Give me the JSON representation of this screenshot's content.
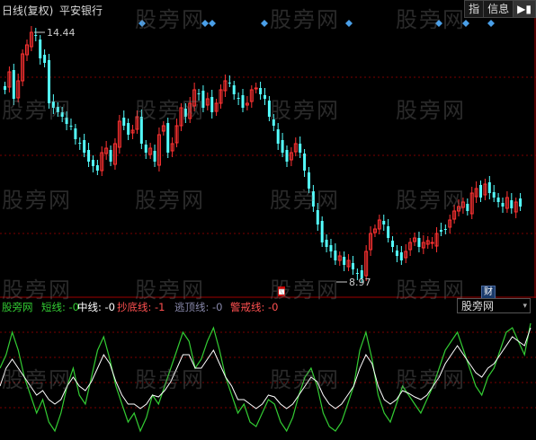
{
  "header": {
    "chart_type_label": "日线(复权)",
    "stock_name": "平安银行"
  },
  "toolbar": {
    "index_button": "指",
    "info_button": "信息",
    "expand_icon": "expand-arrow-icon"
  },
  "main_chart": {
    "high_label": "14.44",
    "low_label": "8.97",
    "finance_marker": "财",
    "colors": {
      "up": "#ff3232",
      "down": "#54ffff",
      "grid": "#7a0000",
      "event_diamond": "#4a9fe8"
    }
  },
  "indicator": {
    "name": "股旁网",
    "short_line": "短线: -0",
    "mid_line": "中线: -0",
    "bottom_line": "抄底线: -1",
    "escape_line": "逃顶线: -0",
    "warn_line": "警戒线: -0",
    "selector_value": "股旁网",
    "colors": {
      "name": "#33cc33",
      "short": "#33cc33",
      "mid": "#ffffff",
      "bottom": "#ff5050",
      "escape": "#8888aa",
      "warn": "#ff5050"
    }
  },
  "watermark": "股旁网"
}
